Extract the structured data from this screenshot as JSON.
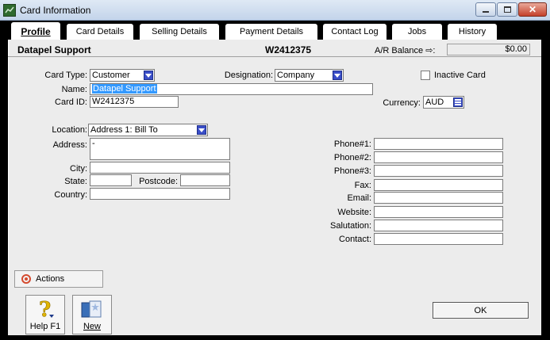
{
  "window": {
    "title": "Card Information"
  },
  "tabs": [
    {
      "label": "Profile"
    },
    {
      "label": "Card Details"
    },
    {
      "label": "Selling Details"
    },
    {
      "label": "Payment Details"
    },
    {
      "label": "Contact Log"
    },
    {
      "label": "Jobs"
    },
    {
      "label": "History"
    }
  ],
  "header": {
    "card_name": "Datapel Support",
    "card_id": "W2412375",
    "ar_balance_label": "A/R Balance ⇨:",
    "ar_balance_value": "$0.00"
  },
  "profile": {
    "card_type_label": "Card Type:",
    "card_type_value": "Customer",
    "designation_label": "Designation:",
    "designation_value": "Company",
    "inactive_label": "Inactive Card",
    "inactive_checked": false,
    "name_label": "Name:",
    "name_value": "Datapel Support",
    "card_id_label": "Card ID:",
    "card_id_value": "W2412375",
    "currency_label": "Currency:",
    "currency_value": "AUD",
    "location_label": "Location:",
    "location_value": "Address 1:  Bill To",
    "address_label": "Address:",
    "address_value": "-",
    "city_label": "City:",
    "city_value": "",
    "state_label": "State:",
    "state_value": "",
    "postcode_label": "Postcode:",
    "postcode_value": "",
    "country_label": "Country:",
    "country_value": "",
    "phone1_label": "Phone#1:",
    "phone2_label": "Phone#2:",
    "phone3_label": "Phone#3:",
    "fax_label": "Fax:",
    "email_label": "Email:",
    "website_label": "Website:",
    "salutation_label": "Salutation:",
    "contact_label": "Contact:"
  },
  "actions": {
    "label": "Actions"
  },
  "toolbar": {
    "help_label": "Help F1",
    "new_label": "New",
    "ok_label": "OK"
  },
  "colors": {
    "selection": "#3399ff",
    "dropdown": "#3a4ec8",
    "action_icon": "#d44b2f"
  }
}
